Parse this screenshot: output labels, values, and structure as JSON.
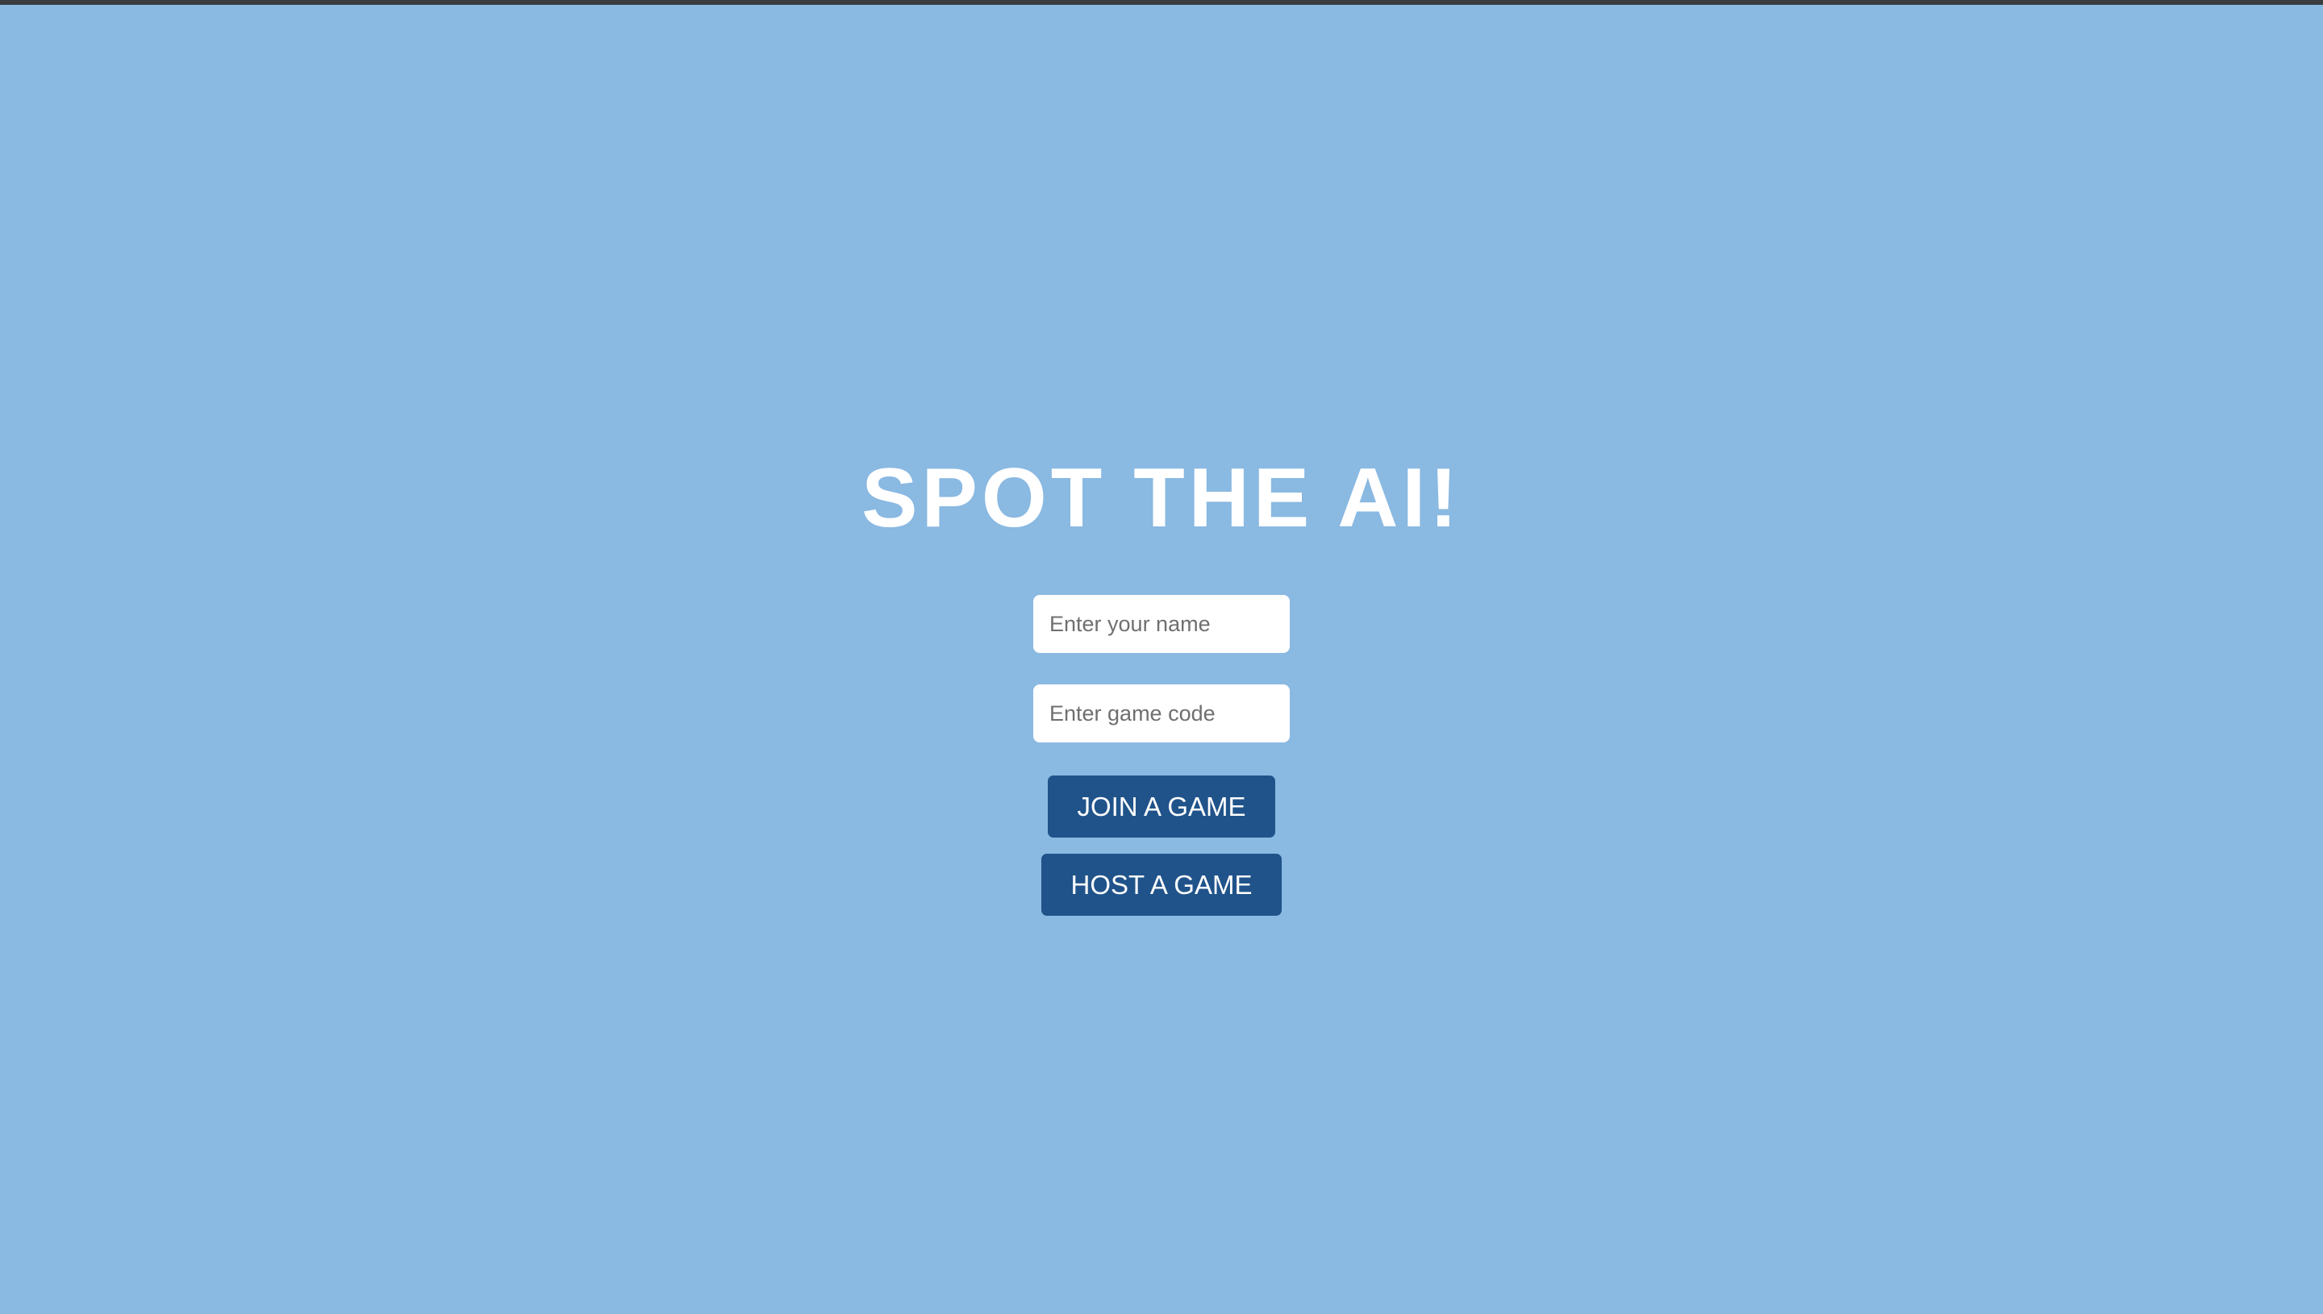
{
  "page": {
    "title": "SPOT THE AI!"
  },
  "form": {
    "name_placeholder": "Enter your name",
    "name_value": "",
    "code_placeholder": "Enter game code",
    "code_value": ""
  },
  "actions": {
    "join_label": "JOIN A GAME",
    "host_label": "HOST A GAME"
  },
  "colors": {
    "background": "#8ab9e2",
    "button": "#20538a",
    "title_text": "#ffffff",
    "top_border": "#3a3d40"
  }
}
